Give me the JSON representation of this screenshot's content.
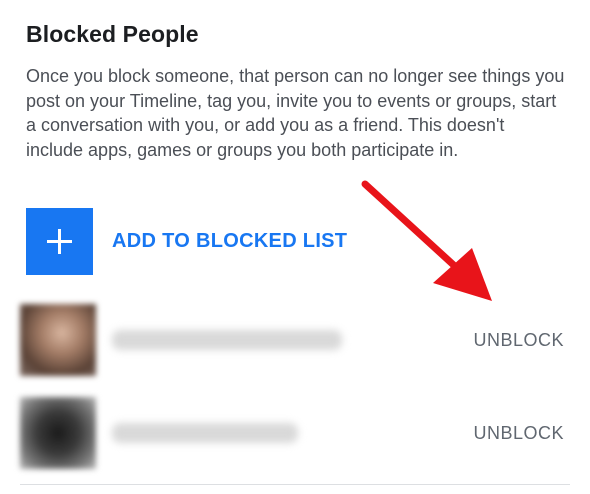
{
  "header": {
    "title": "Blocked People",
    "description": "Once you block someone, that person can no longer see things you post on your Timeline, tag you, invite you to events or groups, start a conversation with you, or add you as a friend. This doesn't include apps, games or groups you both participate in."
  },
  "add_action": {
    "label": "ADD TO BLOCKED LIST",
    "icon": "plus-icon"
  },
  "blocked_list": [
    {
      "unblock_label": "UNBLOCK"
    },
    {
      "unblock_label": "UNBLOCK"
    }
  ],
  "colors": {
    "accent": "#1877f2",
    "annotation_arrow": "#e8141a",
    "secondary_text": "#606770"
  }
}
